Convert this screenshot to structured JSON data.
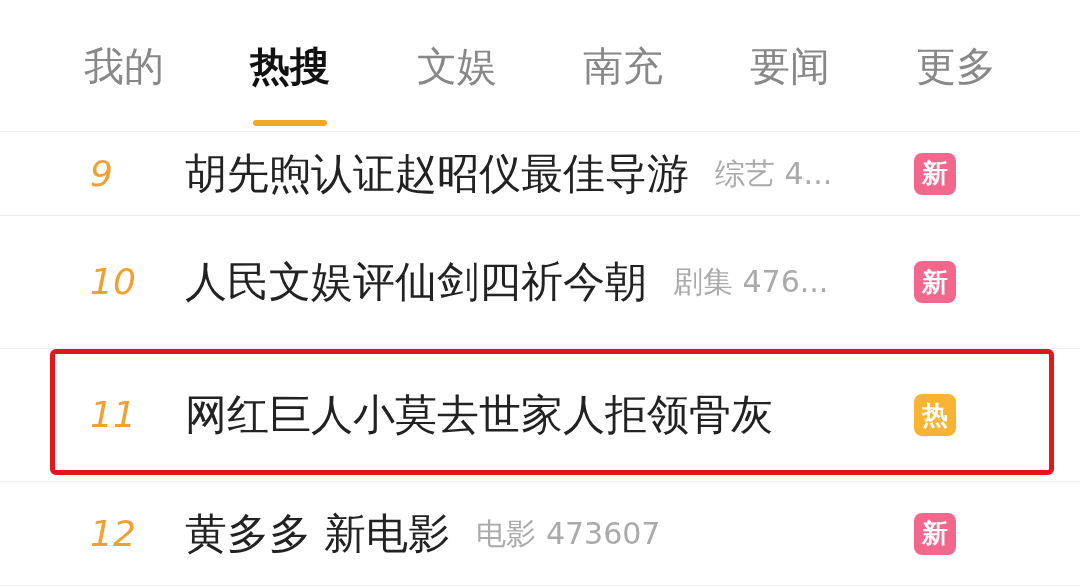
{
  "tabs": [
    {
      "label": "我的",
      "selected": false
    },
    {
      "label": "热搜",
      "selected": true
    },
    {
      "label": "文娱",
      "selected": false
    },
    {
      "label": "南充",
      "selected": false
    },
    {
      "label": "要闻",
      "selected": false
    },
    {
      "label": "更多",
      "selected": false
    }
  ],
  "hot_list": [
    {
      "rank": "9",
      "title": "胡先煦认证赵昭仪最佳导游",
      "category": "综艺 4...",
      "badge": {
        "label": "新",
        "color": "#f4678c"
      },
      "highlighted": false
    },
    {
      "rank": "10",
      "title": "人民文娱评仙剑四祈今朝",
      "category": "剧集 476...",
      "badge": {
        "label": "新",
        "color": "#f4678c"
      },
      "highlighted": false
    },
    {
      "rank": "11",
      "title": "网红巨人小莫去世家人拒领骨灰",
      "badge": {
        "label": "热",
        "color": "#f7b332"
      },
      "highlighted": true
    },
    {
      "rank": "12",
      "title": "黄多多 新电影",
      "category": "电影 473607",
      "badge": {
        "label": "新",
        "color": "#f4678c"
      },
      "highlighted": false
    }
  ]
}
